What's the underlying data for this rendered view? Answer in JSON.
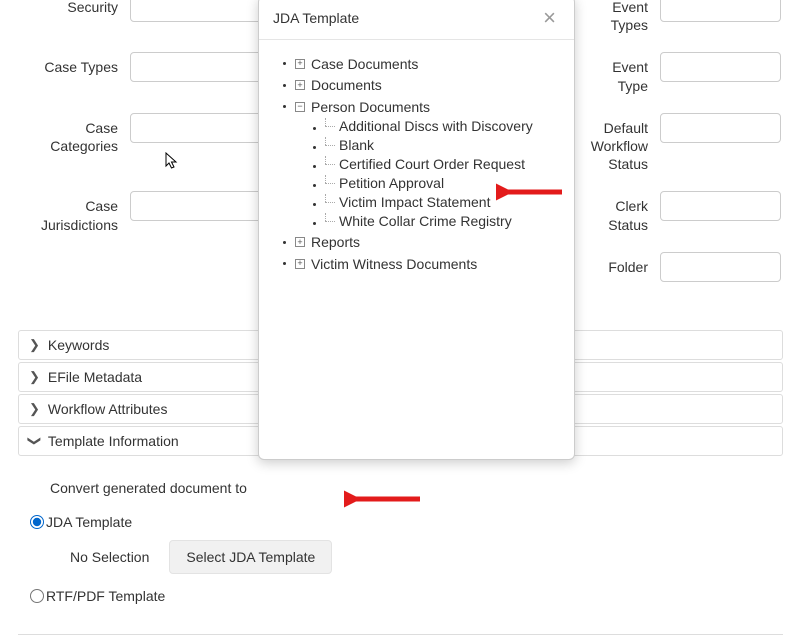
{
  "form": {
    "security_label": "Security",
    "case_types_label": "Case Types",
    "case_categories_label": "Case Categories",
    "case_jurisdictions_label": "Case Jurisdictions",
    "event_types_label": "Event Types",
    "event_type_label": "Event Type",
    "default_workflow_status_label": "Default Workflow Status",
    "clerk_status_label": "Clerk Status",
    "folder_label": "Folder"
  },
  "accordion": {
    "keywords": "Keywords",
    "efile_metadata": "EFile Metadata",
    "workflow_attributes": "Workflow Attributes",
    "template_information": "Template Information"
  },
  "template": {
    "convert_label": "Convert generated document to",
    "jda_template_label": "JDA Template",
    "no_selection": "No Selection",
    "select_jda_button": "Select JDA Template",
    "rtf_pdf_label": "RTF/PDF Template"
  },
  "modal": {
    "title": "JDA Template",
    "tree": {
      "case_documents": "Case Documents",
      "documents": "Documents",
      "person_documents": "Person Documents",
      "children": [
        "Additional Discs with Discovery",
        "Blank",
        "Certified Court Order Request",
        "Petition Approval",
        "Victim Impact Statement",
        "White Collar Crime Registry"
      ],
      "reports": "Reports",
      "victim_witness_documents": "Victim Witness Documents"
    }
  }
}
